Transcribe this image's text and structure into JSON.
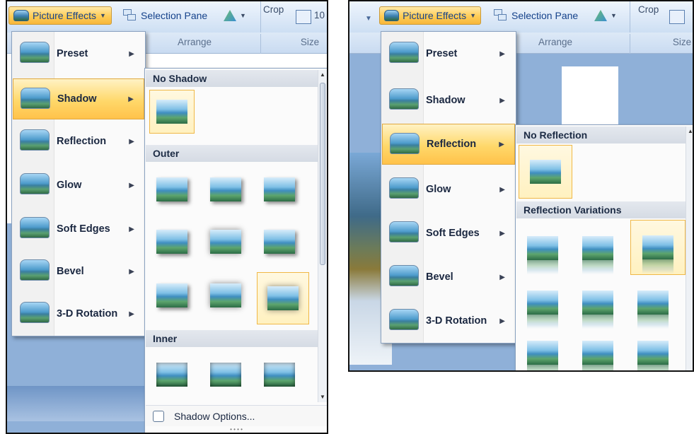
{
  "left": {
    "ribbon": {
      "picture_effects_label": "Picture Effects",
      "selection_pane_label": "Selection Pane",
      "crop_label": "Crop",
      "size_value": "10",
      "arrange_label": "Arrange",
      "size_label": "Size"
    },
    "menu": {
      "items": [
        {
          "label": "Preset"
        },
        {
          "label": "Shadow"
        },
        {
          "label": "Reflection"
        },
        {
          "label": "Glow"
        },
        {
          "label": "Soft Edges"
        },
        {
          "label": "Bevel"
        },
        {
          "label": "3-D Rotation"
        }
      ],
      "active_index": 1
    },
    "gallery": {
      "sections": {
        "none": "No Shadow",
        "outer": "Outer",
        "inner": "Inner"
      },
      "footer_label": "Shadow Options...",
      "selected_outer_index": 8
    }
  },
  "right": {
    "ribbon": {
      "picture_effects_label": "Picture Effects",
      "selection_pane_label": "Selection Pane",
      "crop_label": "Crop",
      "arrange_label": "Arrange",
      "size_label": "Size"
    },
    "menu": {
      "items": [
        {
          "label": "Preset"
        },
        {
          "label": "Shadow"
        },
        {
          "label": "Reflection"
        },
        {
          "label": "Glow"
        },
        {
          "label": "Soft Edges"
        },
        {
          "label": "Bevel"
        },
        {
          "label": "3-D Rotation"
        }
      ],
      "active_index": 2
    },
    "gallery": {
      "sections": {
        "none": "No Reflection",
        "variations": "Reflection Variations"
      },
      "selected_variation_index": 2
    }
  },
  "colors": {
    "active_gradient_top": "#fff2c4",
    "active_gradient_bottom": "#ffc24a",
    "ribbon_text": "#15428b"
  }
}
